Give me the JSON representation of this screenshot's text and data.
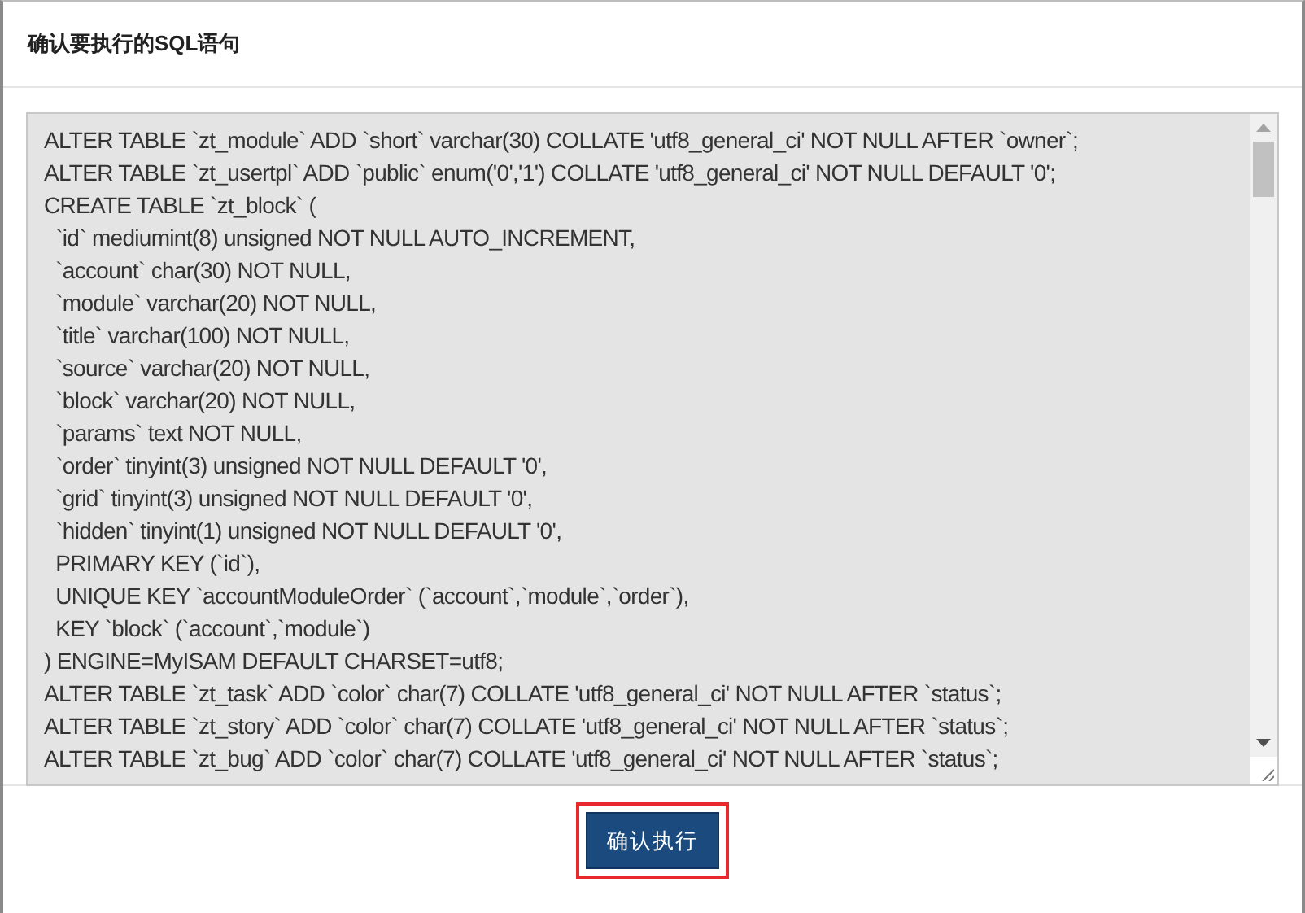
{
  "dialog": {
    "title": "确认要执行的SQL语句",
    "sql_lines": [
      "ALTER TABLE `zt_module` ADD `short` varchar(30) COLLATE 'utf8_general_ci' NOT NULL AFTER `owner`;",
      "ALTER TABLE `zt_usertpl` ADD `public` enum('0','1') COLLATE 'utf8_general_ci' NOT NULL DEFAULT '0';",
      "CREATE TABLE `zt_block` (",
      "  `id` mediumint(8) unsigned NOT NULL AUTO_INCREMENT,",
      "  `account` char(30) NOT NULL,",
      "  `module` varchar(20) NOT NULL,",
      "  `title` varchar(100) NOT NULL,",
      "  `source` varchar(20) NOT NULL,",
      "  `block` varchar(20) NOT NULL,",
      "  `params` text NOT NULL,",
      "  `order` tinyint(3) unsigned NOT NULL DEFAULT '0',",
      "  `grid` tinyint(3) unsigned NOT NULL DEFAULT '0',",
      "  `hidden` tinyint(1) unsigned NOT NULL DEFAULT '0',",
      "  PRIMARY KEY (`id`),",
      "  UNIQUE KEY `accountModuleOrder` (`account`,`module`,`order`),",
      "  KEY `block` (`account`,`module`)",
      ") ENGINE=MyISAM DEFAULT CHARSET=utf8;",
      "ALTER TABLE `zt_task` ADD `color` char(7) COLLATE 'utf8_general_ci' NOT NULL AFTER `status`;",
      "ALTER TABLE `zt_story` ADD `color` char(7) COLLATE 'utf8_general_ci' NOT NULL AFTER `status`;",
      "ALTER TABLE `zt_bug` ADD `color` char(7) COLLATE 'utf8_general_ci' NOT NULL AFTER `status`;"
    ],
    "button": {
      "label": "确认执行",
      "highlighted": true
    }
  }
}
